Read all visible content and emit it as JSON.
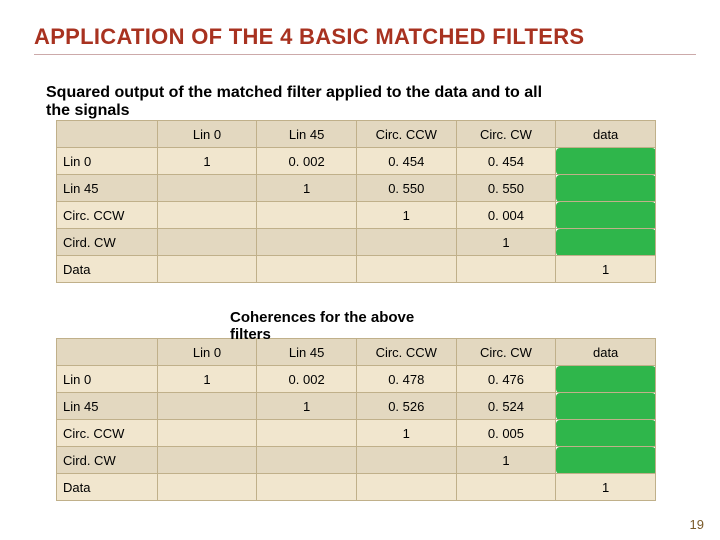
{
  "title": "APPLICATION OF THE 4 BASIC MATCHED FILTERS",
  "subtitle1_line1": "Squared output of the matched filter applied to the data and to all",
  "subtitle1_line2": "the signals",
  "subtitle2_line1": "Coherences for the above",
  "subtitle2_line2": "filters",
  "page_number": "19",
  "columns": [
    "Lin 0",
    "Lin 45",
    "Circ. CCW",
    "Circ. CW",
    "data"
  ],
  "rows": [
    "Lin 0",
    "Lin 45",
    "Circ. CCW",
    "Cird. CW",
    "Data"
  ],
  "table1": {
    "r0": {
      "c0": "1",
      "c1": "0. 002",
      "c2": "0. 454",
      "c3": "0. 454"
    },
    "r1": {
      "c1": "1",
      "c2": "0. 550",
      "c3": "0. 550"
    },
    "r2": {
      "c2": "1",
      "c3": "0. 004"
    },
    "r3": {
      "c3": "1"
    },
    "r4": {
      "c4": "1"
    }
  },
  "table2": {
    "r0": {
      "c0": "1",
      "c1": "0. 002",
      "c2": "0. 478",
      "c3": "0. 476"
    },
    "r1": {
      "c1": "1",
      "c2": "0. 526",
      "c3": "0. 524"
    },
    "r2": {
      "c2": "1",
      "c3": "0. 005"
    },
    "r3": {
      "c3": "1"
    },
    "r4": {
      "c4": "1"
    }
  }
}
